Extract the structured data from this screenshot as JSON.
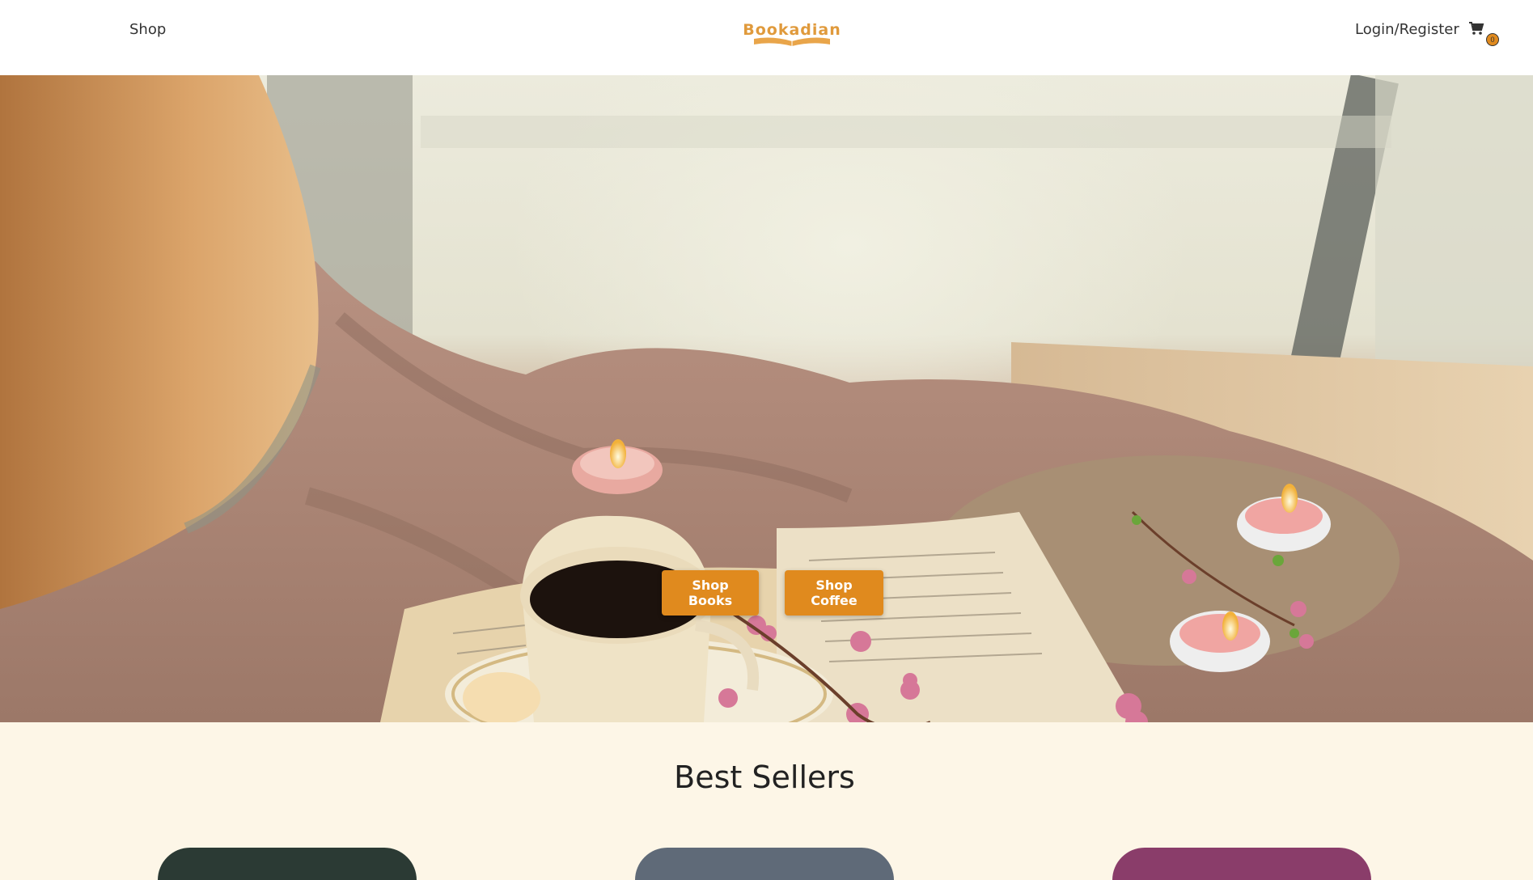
{
  "nav": {
    "shop_label": "Shop",
    "logo_text": "Bookadian",
    "login_label": "Login/Register",
    "cart_count": "0",
    "cart_icon": "cart-icon"
  },
  "hero": {
    "shop_books_label": "Shop Books",
    "shop_coffee_label": "Shop Coffee"
  },
  "bestsellers": {
    "title": "Best Sellers"
  },
  "colors": {
    "accent": "#e08a1e",
    "logo": "#e09a3c",
    "section_bg": "#fdf6e7"
  }
}
